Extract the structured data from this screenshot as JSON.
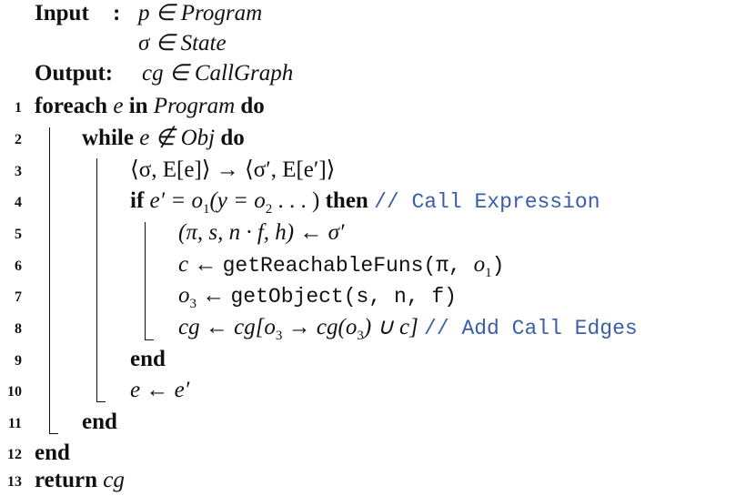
{
  "header": {
    "input_label": "Input",
    "input_colon": ":",
    "input1": "p ∈ Program",
    "input2": "σ ∈ State",
    "output_label": "Output:",
    "output1": "cg ∈ CallGraph"
  },
  "lines": [
    {
      "n": "1"
    },
    {
      "n": "2"
    },
    {
      "n": "3"
    },
    {
      "n": "4"
    },
    {
      "n": "5"
    },
    {
      "n": "6"
    },
    {
      "n": "7"
    },
    {
      "n": "8"
    },
    {
      "n": "9"
    },
    {
      "n": "10"
    },
    {
      "n": "11"
    },
    {
      "n": "12"
    },
    {
      "n": "13"
    }
  ],
  "kw": {
    "foreach": "foreach",
    "in": "in",
    "do": "do",
    "while": "while",
    "if": "if",
    "then": "then",
    "end": "end",
    "return": "return"
  },
  "code": {
    "l1_e": "e",
    "l1_prog": "Program",
    "l2_cond": "e ∉ Obj",
    "l3": "⟨σ, E[e]⟩ → ⟨σ′, E[e′]⟩",
    "l4_cond": "e′ = o",
    "l4_sub1": "1",
    "l4_mid": "(y = o",
    "l4_sub2": "2",
    "l4_end": " . . . )",
    "l4_comment": "// Call Expression",
    "l5": "(π, s, n · f, h) ← σ′",
    "l6_lhs": "c ←",
    "l6_fn": "getReachableFuns",
    "l6_args_a": "(π, ",
    "l6_args_o": "o",
    "l6_args_sub": "1",
    "l6_args_b": ")",
    "l7_lhs_o": "o",
    "l7_lhs_sub": "3",
    "l7_arrow": " ←",
    "l7_fn": "getObject",
    "l7_args": "(s, n, f)",
    "l8_a": "cg ← cg[o",
    "l8_s1": "3",
    "l8_b": " → cg(o",
    "l8_s2": "3",
    "l8_c": ") ∪ c]",
    "l8_comment": "// Add Call Edges",
    "l10": "e ← e′",
    "l13": "cg"
  }
}
